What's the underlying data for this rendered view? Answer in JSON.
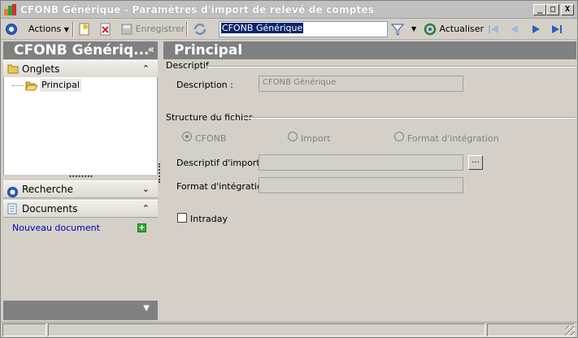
{
  "window": {
    "title": "CFONB Générique - Paramètres d'import de relevé de comptes",
    "controls": {
      "minimize": "_",
      "maximize": "□",
      "close": "X"
    }
  },
  "toolbar": {
    "actions_label": "Actions",
    "save_label": "Enregistrer",
    "search_value": "CFONB Générique",
    "refresh_label": "Actualiser"
  },
  "left_panel": {
    "title": "CFONB Génériq...",
    "collapse_glyph": "«",
    "onglets": {
      "label": "Onglets",
      "chevron": "⌃",
      "items": [
        {
          "label": "Principal"
        }
      ]
    },
    "recherche": {
      "label": "Recherche",
      "chevron": "⌄"
    },
    "documents": {
      "label": "Documents",
      "chevron": "⌃",
      "new_document_label": "Nouveau document",
      "add_glyph": "+"
    },
    "footer_glyph": "▼"
  },
  "main": {
    "title": "Principal",
    "descriptif": {
      "group_title": "Descriptif",
      "description_label": "Description :",
      "description_value": "CFONB Générique"
    },
    "structure": {
      "group_title": "Structure du fichier",
      "options": [
        {
          "label": "CFONB",
          "checked": true
        },
        {
          "label": "Import",
          "checked": false
        },
        {
          "label": "Format d'intégration",
          "checked": false
        }
      ],
      "import_desc_label": "Descriptif d'import :",
      "import_desc_value": "",
      "browse_label": "...",
      "format_label": "Format d'intégration :",
      "format_value": ""
    },
    "intraday_label": "Intraday",
    "intraday_checked": false
  },
  "colors": {
    "header_bg": "#808080",
    "accent_blue": "#2a5ec0",
    "link_blue": "#0000c0",
    "window_bg": "#d4d0c8"
  }
}
